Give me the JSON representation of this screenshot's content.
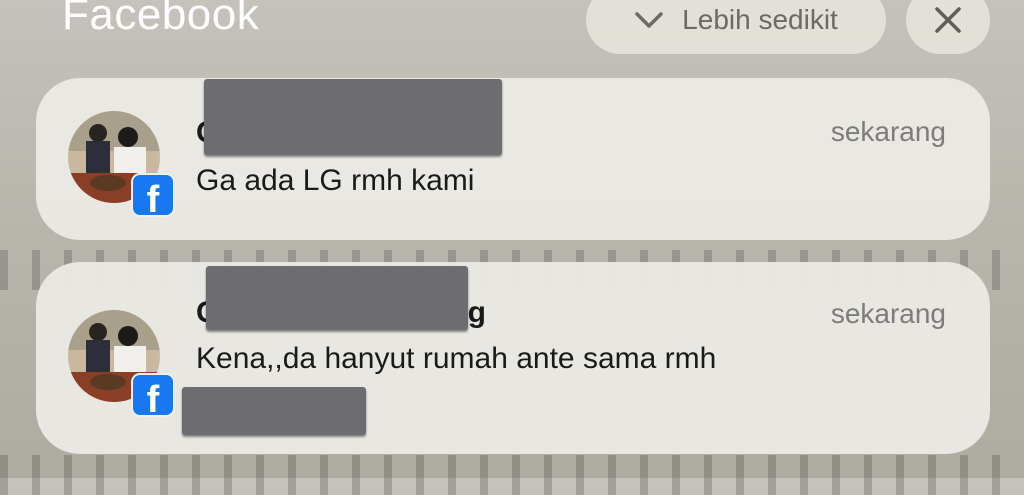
{
  "header": {
    "app_title": "Facebook",
    "collapse_label": "Lebih sedikit",
    "collapse_icon": "chevron-down-icon",
    "close_icon": "close-icon"
  },
  "notifications": [
    {
      "sender_visible": "G",
      "time": "sekarang",
      "message": "Ga ada LG rmh kami",
      "app_icon": "facebook-icon"
    },
    {
      "sender_visible_start": "G",
      "sender_visible_end": "ng",
      "time": "sekarang",
      "message": "Kena,,da hanyut rumah ante sama rmh",
      "app_icon": "facebook-icon"
    }
  ],
  "colors": {
    "facebook_blue": "#1877f2",
    "card_bg": "#eeece6",
    "redaction": "#6d6d71"
  }
}
